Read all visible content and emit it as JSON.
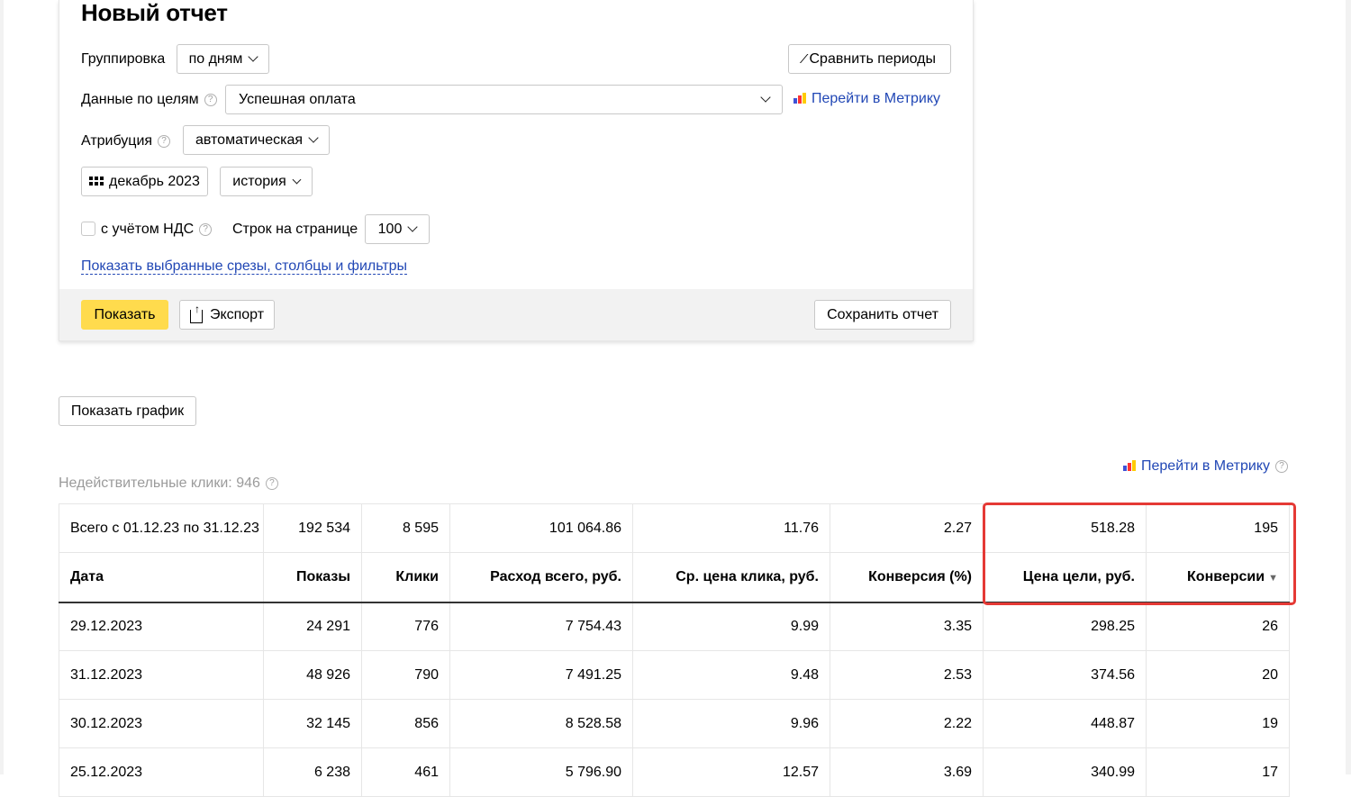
{
  "report": {
    "title": "Новый отчет",
    "grouping": {
      "label": "Группировка",
      "value": "по дням"
    },
    "compare_button": "Сравнить периоды",
    "compare_icon": "percent-compare-icon",
    "goals": {
      "label": "Данные по целям",
      "value": "Успешная оплата"
    },
    "metrika_link": "Перейти в Метрику",
    "attribution": {
      "label": "Атрибуция",
      "value": "автоматическая"
    },
    "period": {
      "value": "декабрь 2023",
      "icon": "calendar-grid-icon"
    },
    "history_select": "история",
    "vat_label": "с учётом НДС",
    "rows_per_page": {
      "label": "Строк на странице",
      "value": "100"
    },
    "show_filters_link": "Показать выбранные срезы, столбцы и фильтры",
    "show_button": "Показать",
    "export_button": "Экспорт",
    "save_button": "Сохранить отчет"
  },
  "chart_toggle": "Показать график",
  "invalid_clicks": "Недействительные клики: 946",
  "metrika_link_2": "Перейти в Метрику",
  "table": {
    "total": [
      "Всего с 01.12.23 по 31.12.23",
      "192 534",
      "8 595",
      "101 064.86",
      "11.76",
      "2.27",
      "518.28",
      "195"
    ],
    "headers": [
      "Дата",
      "Показы",
      "Клики",
      "Расход всего, руб.",
      "Ср. цена клика, руб.",
      "Конверсия (%)",
      "Цена цели, руб.",
      "Конверсии"
    ],
    "sort_indicator": "▼",
    "rows": [
      [
        "29.12.2023",
        "24 291",
        "776",
        "7 754.43",
        "9.99",
        "3.35",
        "298.25",
        "26"
      ],
      [
        "31.12.2023",
        "48 926",
        "790",
        "7 491.25",
        "9.48",
        "2.53",
        "374.56",
        "20"
      ],
      [
        "30.12.2023",
        "32 145",
        "856",
        "8 528.58",
        "9.96",
        "2.22",
        "448.87",
        "19"
      ],
      [
        "25.12.2023",
        "6 238",
        "461",
        "5 796.90",
        "12.57",
        "3.69",
        "340.99",
        "17"
      ]
    ]
  },
  "colors": {
    "accent_yellow": "#ffdb4d",
    "link_blue": "#2147b5",
    "highlight_red": "#e53935"
  }
}
